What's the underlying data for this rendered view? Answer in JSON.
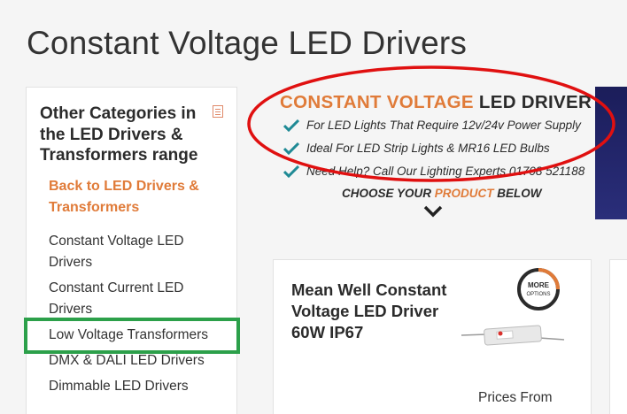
{
  "page": {
    "title": "Constant Voltage LED Drivers"
  },
  "sidebar": {
    "heading": "Other Categories in the LED Drivers & Transformers range",
    "back_link": "Back to LED Drivers & Transformers",
    "items": [
      {
        "label": "Constant Voltage LED Drivers"
      },
      {
        "label": "Constant Current LED Drivers"
      },
      {
        "label": "Low Voltage Transformers"
      },
      {
        "label": "DMX & DALI LED Drivers"
      },
      {
        "label": "Dimmable LED Drivers"
      }
    ]
  },
  "banner": {
    "title_part1": "CONSTANT VOLTAGE",
    "title_part2": " LED DRIVER",
    "bullets": [
      "For LED Lights That Require 12v/24v Power Supply",
      "Ideal For LED Strip Lights & MR16 LED Bulbs",
      "Need Help? Call Our Lighting Experts 01708 521188"
    ],
    "choose_part1": "CHOOSE YOUR ",
    "choose_part2": "PRODUCT",
    "choose_part3": " BELOW"
  },
  "product": {
    "name": "Mean Well Constant Voltage LED Driver 60W IP67",
    "badge_line1": "MORE",
    "badge_line2": "OPTIONS",
    "prices_label": "Prices From"
  },
  "colors": {
    "accent_orange": "#e07b39",
    "annotation_red": "#e01010",
    "annotation_green": "#2ca04a",
    "check_teal": "#1f8a95"
  }
}
